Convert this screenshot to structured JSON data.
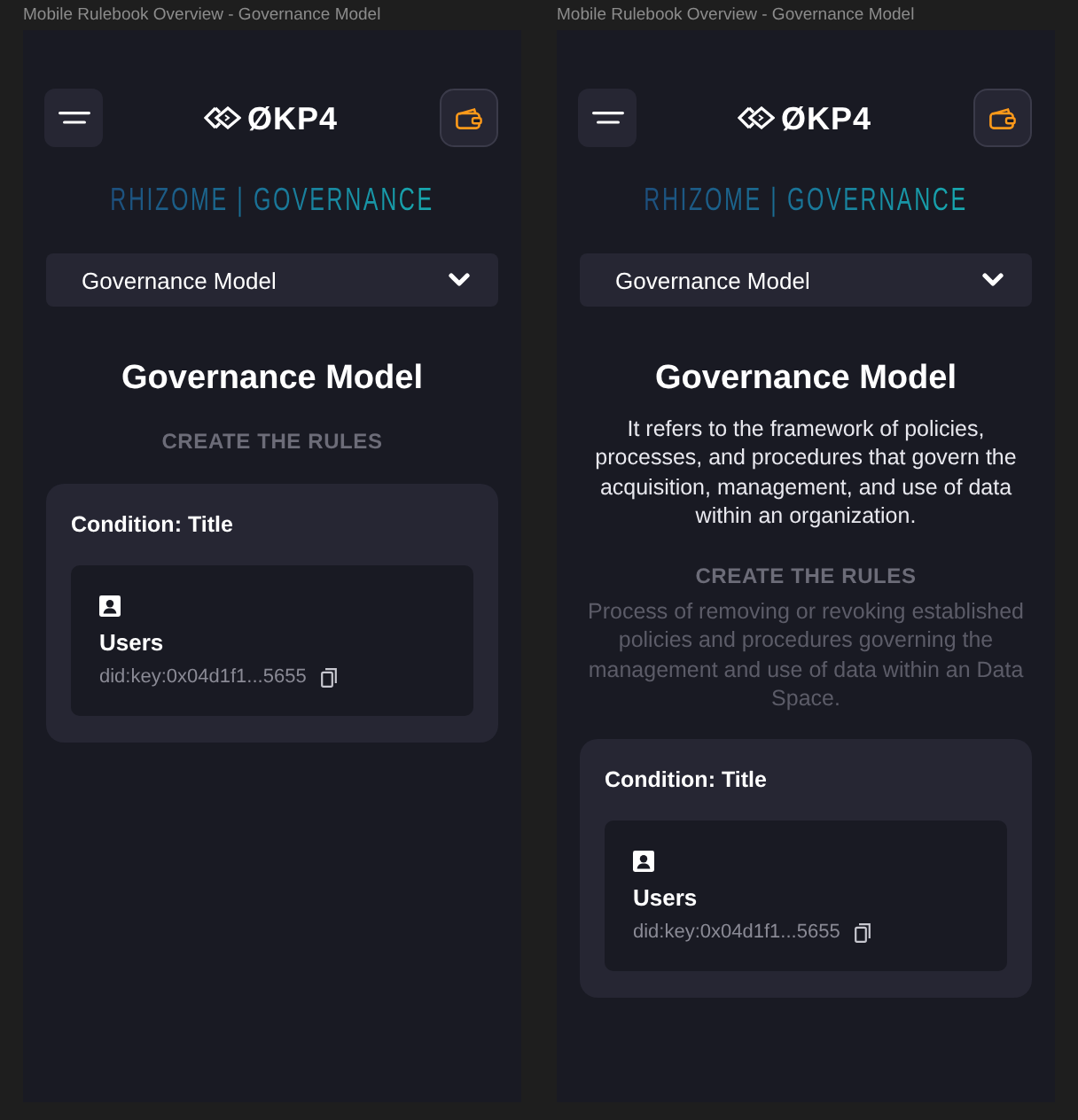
{
  "frames": [
    {
      "label": "Mobile Rulebook Overview - Governance Model",
      "logo_text": "ØKP4",
      "brand": "RHIZOME | GOVERNANCE",
      "dropdown": {
        "value": "Governance Model"
      },
      "title": "Governance Model",
      "section_heading": "CREATE THE RULES",
      "condition": {
        "title": "Condition: Title",
        "entity": {
          "name": "Users",
          "did": "did:key:0x04d1f1...5655"
        }
      }
    },
    {
      "label": "Mobile Rulebook Overview - Governance Model",
      "logo_text": "ØKP4",
      "brand": "RHIZOME | GOVERNANCE",
      "dropdown": {
        "value": "Governance Model"
      },
      "title": "Governance Model",
      "description": "It refers to the framework of policies, processes, and procedures that govern the acquisition, management, and use of data within an organization.",
      "section_heading": "CREATE THE RULES",
      "section_text": "Process of removing or revoking established policies and procedures governing the management and use of data within an Data Space.",
      "condition": {
        "title": "Condition: Title",
        "entity": {
          "name": "Users",
          "did": "did:key:0x04d1f1...5655"
        }
      }
    }
  ]
}
